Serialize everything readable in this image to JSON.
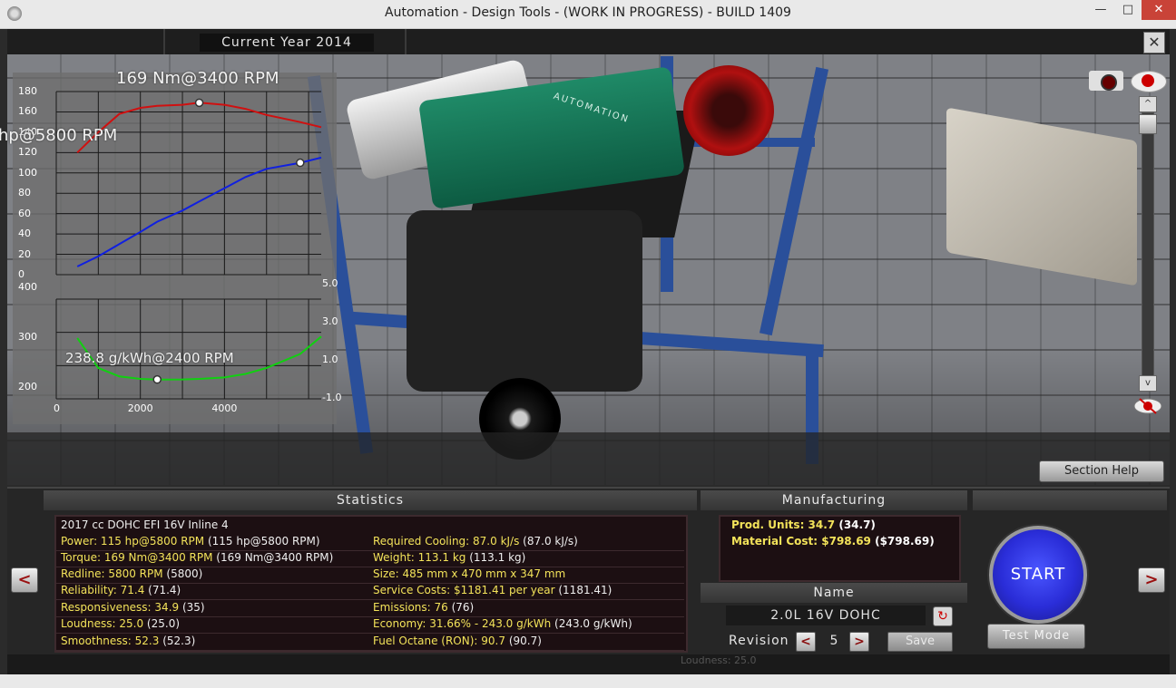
{
  "window": {
    "title": "Automation - Design Tools - (WORK IN PROGRESS) - BUILD 1409",
    "minimize": "—",
    "maximize": "□",
    "close": "✕"
  },
  "viewport": {
    "year": "Current Year 2014",
    "close": "✕",
    "section_help": "Section Help",
    "valve_cover_text": "AUTOMATION",
    "zoom_up": "^",
    "zoom_down": "v"
  },
  "graph": {
    "torque_label": "169 Nm@3400 RPM",
    "power_label": "hp@5800 RPM",
    "bsfc_label": "238.8 g/kWh@2400 RPM",
    "top_y_ticks": [
      "180",
      "160",
      "140",
      "120",
      "100",
      "80",
      "60",
      "40",
      "20",
      "0"
    ],
    "bottom_left_ticks": [
      "400",
      "300",
      "200"
    ],
    "bottom_right_ticks": [
      "5.0",
      "3.0",
      "1.0",
      "-1.0"
    ],
    "x_ticks": [
      "0",
      "2000",
      "4000"
    ],
    "colors": {
      "torque": "#d01010",
      "power": "#1020e0",
      "bsfc": "#10d010"
    }
  },
  "chart_data": {
    "type": "line",
    "x": [
      500,
      1000,
      1500,
      2000,
      2400,
      3000,
      3400,
      4000,
      4500,
      5000,
      5800,
      6300
    ],
    "series": [
      {
        "values": [
          120,
          140,
          158,
          164,
          166,
          167,
          169,
          167,
          163,
          157,
          150,
          145
        ]
      },
      {
        "values": [
          8,
          18,
          30,
          42,
          52,
          63,
          72,
          85,
          96,
          104,
          110,
          115
        ]
      },
      {
        "values": [
          322,
          262,
          245,
          240,
          238.8,
          239,
          240,
          243,
          250,
          262,
          290,
          325
        ]
      }
    ],
    "torque_range": [
      0,
      180
    ],
    "bsfc_range": [
      200,
      400
    ],
    "x_range": [
      0,
      6300
    ]
  },
  "statistics": {
    "header": "Statistics",
    "description": "2017 cc DOHC EFI 16V Inline 4",
    "left": [
      {
        "label": "Power: 115 hp@5800 RPM",
        "paren": " (115 hp@5800 RPM)"
      },
      {
        "label": "Torque: 169 Nm@3400 RPM",
        "paren": " (169 Nm@3400 RPM)"
      },
      {
        "label": "Redline: 5800 RPM",
        "paren": " (5800)"
      },
      {
        "label": "Reliability: 71.4",
        "paren": " (71.4)"
      },
      {
        "label": "Responsiveness: 34.9",
        "paren": " (35)"
      },
      {
        "label": "Loudness: 25.0",
        "paren": " (25.0)"
      },
      {
        "label": "Smoothness: 52.3",
        "paren": " (52.3)"
      }
    ],
    "right": [
      {
        "label": "Required Cooling: 87.0 kJ/s",
        "paren": " (87.0 kJ/s)"
      },
      {
        "label": "Weight: 113.1 kg",
        "paren": " (113.1 kg)"
      },
      {
        "label": "Size: 485 mm x 470 mm x 347 mm",
        "paren": ""
      },
      {
        "label": "Service Costs: $1181.41 per year",
        "paren": " (1181.41)"
      },
      {
        "label": "Emissions: 76",
        "paren": " (76)"
      },
      {
        "label": "Economy: 31.66% - 243.0 g/kWh",
        "paren": " (243.0 g/kWh)"
      },
      {
        "label": "Fuel Octane (RON): 90.7",
        "paren": " (90.7)"
      }
    ]
  },
  "manufacturing": {
    "header": "Manufacturing",
    "rows": [
      {
        "label": "Prod. Units: 34.7",
        "paren": " (34.7)"
      },
      {
        "label": "Material Cost: $798.69",
        "paren": " ($798.69)"
      }
    ]
  },
  "name_section": {
    "header": "Name",
    "value": "2.0L 16V DOHC",
    "revision_label": "Revision",
    "revision_value": "5",
    "prev": "<",
    "next": ">",
    "save": "Save",
    "refresh": "↻"
  },
  "start": {
    "label": "START",
    "test_mode": "Test Mode"
  },
  "navigation": {
    "left": "<",
    "right": ">"
  },
  "footer": {
    "ghost": "Loudness: 25.0"
  }
}
